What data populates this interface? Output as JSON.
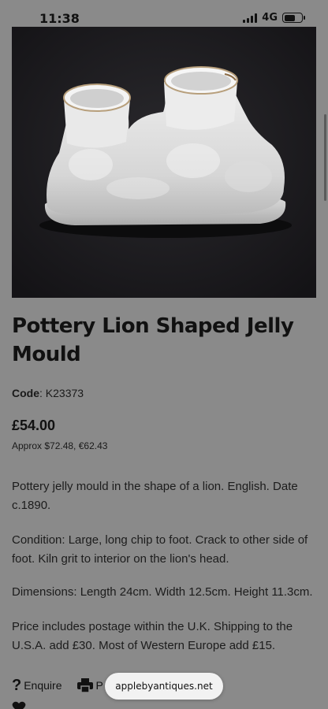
{
  "status_bar": {
    "time": "11:38",
    "network": "4G"
  },
  "product": {
    "title": "Pottery Lion Shaped Jelly Mould",
    "code_label": "Code",
    "code_value": ": K23373",
    "price": "£54.00",
    "approx": "Approx $72.48, €62.43",
    "description": [
      "Pottery jelly mould in the shape of a lion. English. Date c.1890.",
      "Condition: Large, long chip to foot. Crack to other side of foot. Kiln grit to interior on the lion's head.",
      "Dimensions: Length 24cm. Width 12.5cm.  Height 11.3cm.",
      "Price includes postage within the U.K. Shipping to the U.S.A. add £30. Most of Western Europe add £15."
    ]
  },
  "actions": {
    "enquire_label": "Enquire",
    "print_label": "P"
  },
  "browser": {
    "url": "applebyantiques.net"
  },
  "colors": {
    "page_background": "#8a8a8a",
    "image_background": "#1b1a1d",
    "text": "#161616"
  },
  "icons": {
    "enquire": "question-mark-icon",
    "print": "printer-icon",
    "wishlist": "heart-icon"
  }
}
